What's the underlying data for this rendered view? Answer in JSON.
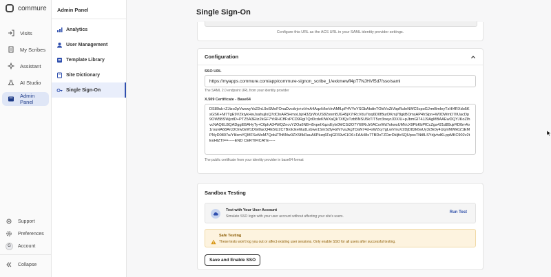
{
  "brand": {
    "name": "commure"
  },
  "nav": {
    "items": [
      {
        "label": "Visits",
        "icon": "login-icon"
      },
      {
        "label": "My Scribes",
        "icon": "document-icon"
      },
      {
        "label": "Assistant",
        "icon": "sparkle-icon"
      },
      {
        "label": "AI Studio",
        "icon": "flask-icon"
      },
      {
        "label": "Admin Panel",
        "icon": "admin-icon",
        "active": true
      }
    ],
    "bottom": [
      {
        "label": "Support",
        "icon": "gear-icon"
      },
      {
        "label": "Preferences",
        "icon": "settings-icon"
      },
      {
        "label": "Account",
        "avatar": "G"
      },
      {
        "label": "Collapse",
        "icon": "collapse-icon"
      }
    ]
  },
  "subnav": {
    "title": "Admin Panel",
    "items": [
      {
        "label": "Analytics"
      },
      {
        "label": "User Management"
      },
      {
        "label": "Template Library"
      },
      {
        "label": "Site Dictionary"
      },
      {
        "label": "Single Sign-On",
        "active": true
      }
    ]
  },
  "page": {
    "title": "Single Sign-On",
    "acs_hint": "Configure this URL as the ACS URL in your SAML identity provider settings."
  },
  "config": {
    "title": "Configuration",
    "sso_url_label": "SSO URL",
    "sso_url_value": "https://myapps.commure.com/app/commure-signon_scribe_1/exkmewff4pT7NJHVf5d7/sso/saml",
    "sso_url_help": "The SAML 2.0 endpoint URL from your identity provider",
    "cert_label": "X.509 Certificate - Base64",
    "cert_value": "DS89uk+ZJtzo2pVwswyYa22nL9oSMoFOnaDvcdvjo+zVmA4AqziVbeVnAMfLpP4VYoYSGbAkdtvTOIdVxZiVbpRuInNWC5cpoGJrmBmIeyTzHl4RXdo5KsGSK+Nl7TgE9VZktykHwJxahujIxQ7dClnAR5HmoLbjrH3ZjrWxUS82onmBJG45jX7rRcVdu7toq6D0fBurDKmj78gkBOmsAP4hSlpn+W0DWmD7lIUacDp9OW5BSWjzdD+PTZ5A3Eliz2kGF7YtRHCffFxPCD9Rgi7Qd0cdeKfWXaQkTXfQvTzbBNSU5kT/T5zc3oeyrJDX/U+pJbmGI74JJ9AgMBAAEwDQYJKoZIhvcNAQELBQADggEBAHyTy+C6phA34WQZncvYZOa6NB+i5vpeIXqzxEylx0MCSt2O7Y60RrJr6ACxrWd7okwsUMVcX9PbKbPfCcZga421d89ujrRD0m4o1rouviA68A/cDOrw0sW1DGI0acQ4E5iU2C7B/olcEe6ludLxbwe1SmS2lyHzN7vaJkgTDaN74d+sW2xy7gLwVmuV2DjD82k6wUy3r3k0y4UqmMWk0Z1EMPNyD0807u/YIilxmYQMFSeMoM7QobZThBNw0ZXSfIkRauA6Pkzq6FojGF69vK1O6+FAA48s7TBDxTZDzrDkljfeSQUposTNt8LSYdjvhdKLppMKC902v2tEoHIZTI==-----END CERTIFICATE-----",
    "cert_help": "The public certificate from your identity provider in base64 format"
  },
  "sandbox": {
    "title": "Sandbox Testing",
    "test_title": "Test with Your User Account",
    "test_desc": "Simulate SSO login with your user account without affecting your site's users.",
    "run_test_label": "Run Test",
    "warn_title": "Safe Testing",
    "warn_desc": "These tests won't log you out or affect existing user sessions. Only enable SSO for all users after successful testing.",
    "save_label": "Save and Enable SSO"
  },
  "colors": {
    "accent": "#2f4fae",
    "active_bg": "#dfe6f6",
    "warning_bg": "#fdf3df"
  }
}
